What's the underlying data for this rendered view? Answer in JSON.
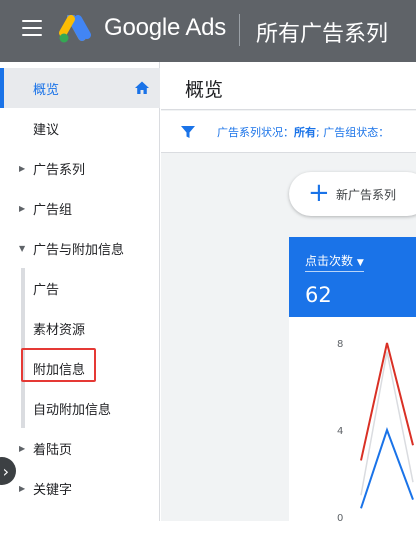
{
  "header": {
    "brand": "Google Ads",
    "campaign_title": "所有广告系列"
  },
  "sidebar": {
    "items": [
      {
        "label": "概览",
        "active": true
      },
      {
        "label": "建议"
      },
      {
        "label": "广告系列"
      },
      {
        "label": "广告组"
      },
      {
        "label": "广告与附加信息"
      },
      {
        "label": "广告"
      },
      {
        "label": "素材资源"
      },
      {
        "label": "附加信息"
      },
      {
        "label": "自动附加信息"
      },
      {
        "label": "着陆页"
      },
      {
        "label": "关键字"
      }
    ]
  },
  "main": {
    "page_title": "概览",
    "filter": {
      "prefix": "广告系列状况：",
      "value": "所有",
      "rest": "; 广告组状态："
    },
    "new_campaign_label": "新广告系列",
    "card": {
      "metric_label": "点击次数",
      "metric_value": "62"
    }
  },
  "colors": {
    "accent": "#1a73e8",
    "topbar": "#5f6368",
    "highlight_box": "#e53935",
    "series_red": "#d93025",
    "series_blue": "#1a73e8"
  },
  "chart_data": {
    "type": "line",
    "ylim": [
      0,
      8
    ],
    "yticks": [
      "8",
      "4",
      "0"
    ],
    "series": [
      {
        "color": "#d93025",
        "values": [
          2.6,
          8,
          3.3
        ]
      },
      {
        "color": "#1a73e8",
        "values": [
          0.4,
          4,
          0.8
        ]
      }
    ]
  }
}
